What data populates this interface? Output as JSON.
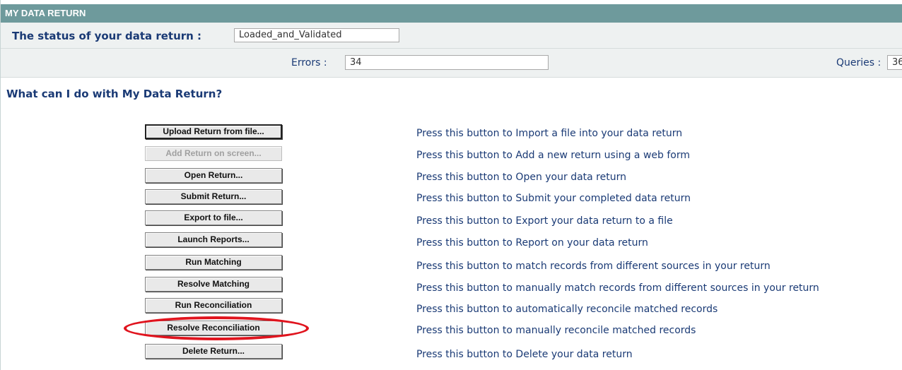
{
  "header": {
    "title": "MY DATA RETURN"
  },
  "status": {
    "label": "The status of your data return :",
    "value": "Loaded_and_Validated"
  },
  "counts": {
    "errors_label": "Errors :",
    "errors_value": "34",
    "queries_label": "Queries :",
    "queries_value": "36"
  },
  "section": {
    "heading": "What can I do with My Data Return?"
  },
  "actions": [
    {
      "label": "Upload Return from file...",
      "description": "Press this button to Import a file into your data return"
    },
    {
      "label": "Add Return on screen...",
      "description": "Press this button to Add a new return using a web form"
    },
    {
      "label": "Open Return...",
      "description": "Press this button to Open your data return"
    },
    {
      "label": "Submit Return...",
      "description": "Press this button to Submit your completed data return"
    },
    {
      "label": "Export to file...",
      "description": "Press this button to Export your data return to a file"
    },
    {
      "label": "Launch Reports...",
      "description": "Press this button to Report on your data return"
    },
    {
      "label": "Run Matching",
      "description": "Press this button to match records from different sources in your return"
    },
    {
      "label": "Resolve Matching",
      "description": "Press this button to manually match records from different sources in your return"
    },
    {
      "label": "Run Reconciliation",
      "description": "Press this button to automatically reconcile matched records"
    },
    {
      "label": "Resolve Reconciliation",
      "description": "Press this button to manually reconcile matched records"
    },
    {
      "label": "Delete Return...",
      "description": "Press this button to Delete your data return"
    }
  ],
  "colors": {
    "header_bg": "#6e9a9c",
    "text_blue": "#1a3a75",
    "highlight": "#e0141e"
  }
}
